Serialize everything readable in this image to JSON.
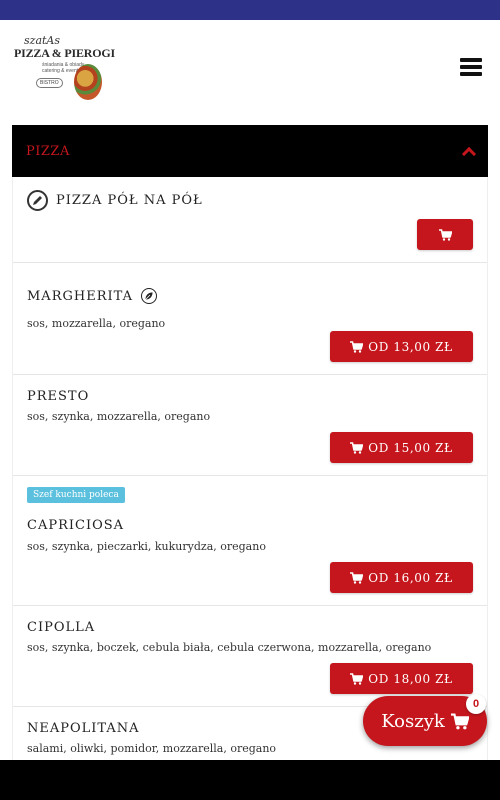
{
  "header": {
    "logo": {
      "script": "szatAs",
      "brand": "PIZZA & PIEROGI",
      "tagline1": "śniadania & obiady",
      "tagline2": "catering & eventy",
      "badge": "BISTRO"
    },
    "menu_icon": "hamburger-icon"
  },
  "category": {
    "title": "PIZZA",
    "expanded": true,
    "toggle_icon": "chevron-up-icon"
  },
  "items": [
    {
      "name": "PIZZA PÓŁ NA PÓŁ",
      "icon": "edit-icon",
      "desc": "",
      "badge": "",
      "price": ""
    },
    {
      "name": "MARGHERITA",
      "icon": "leaf-icon",
      "desc": "sos, mozzarella, oregano",
      "badge": "",
      "price": "OD 13,00 ZŁ"
    },
    {
      "name": "PRESTO",
      "icon": "",
      "desc": "sos, szynka, mozzarella, oregano",
      "badge": "",
      "price": "OD 15,00 ZŁ"
    },
    {
      "name": "CAPRICIOSA",
      "icon": "",
      "desc": "sos, szynka, pieczarki, kukurydza, oregano",
      "badge": "Szef kuchni poleca",
      "price": "OD 16,00 ZŁ"
    },
    {
      "name": "CIPOLLA",
      "icon": "",
      "desc": "sos, szynka, boczek, cebula biała, cebula czerwona, mozzarella, oregano",
      "badge": "",
      "price": "OD 18,00 ZŁ"
    },
    {
      "name": "NEAPOLITANA",
      "icon": "",
      "desc": "salami, oliwki, pomidor, mozzarella, oregano",
      "badge": "",
      "price": ""
    }
  ],
  "cart": {
    "label": "Koszyk",
    "count": "0"
  },
  "colors": {
    "accent": "#c4161c",
    "status_bar": "#2d3187",
    "badge": "#5bc0de"
  }
}
